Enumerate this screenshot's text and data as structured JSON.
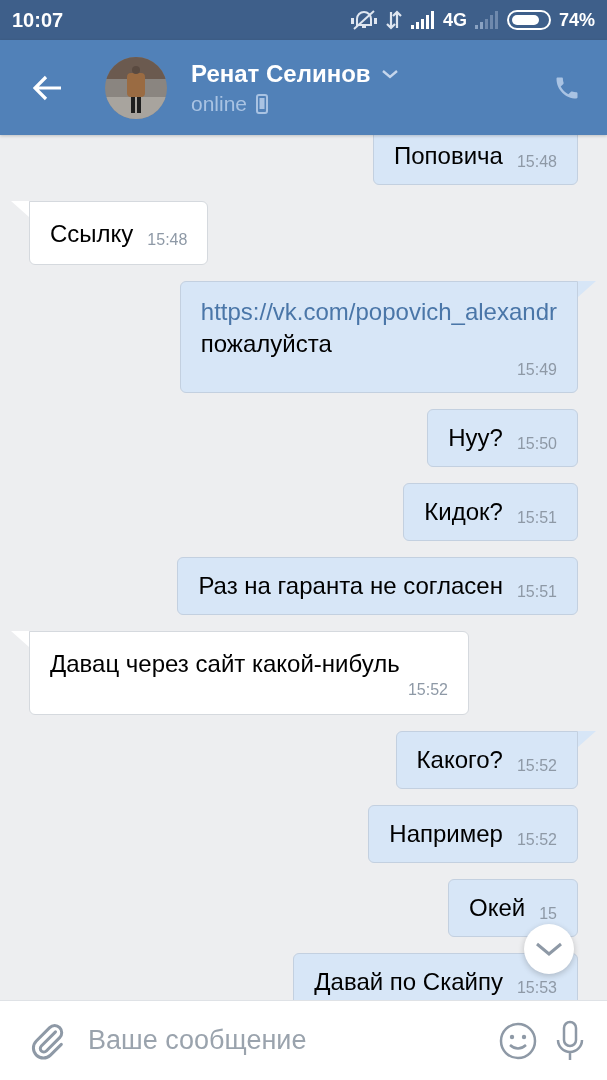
{
  "status_bar": {
    "time": "10:07",
    "network": "4G",
    "battery": "74%"
  },
  "header": {
    "name": "Ренат Селинов",
    "presence": "online"
  },
  "messages": [
    {
      "kind": "outgoing",
      "text": "Поповича",
      "time": "15:48"
    },
    {
      "kind": "incoming",
      "text": "Ссылку",
      "time": "15:48",
      "tail": true
    },
    {
      "kind": "outgoing",
      "link": "https://vk.com/popovich_alexandr",
      "text": "пожалуйста",
      "time": "15:49",
      "tail": true
    },
    {
      "kind": "outgoing",
      "text": "Нуу?",
      "time": "15:50",
      "tail": false
    },
    {
      "kind": "outgoing",
      "text": "Кидок?",
      "time": "15:51",
      "tail": false
    },
    {
      "kind": "outgoing",
      "text": "Раз на гаранта не согласен",
      "time": "15:51",
      "tail": false
    },
    {
      "kind": "incoming",
      "text": "Давац через сайт какой-нибуль",
      "time": "15:52",
      "tail": true
    },
    {
      "kind": "outgoing",
      "text": "Какого?",
      "time": "15:52",
      "tail": true
    },
    {
      "kind": "outgoing",
      "text": "Например",
      "time": "15:52",
      "tail": false
    },
    {
      "kind": "outgoing",
      "text": "Окей",
      "time": "15",
      "tail": false
    },
    {
      "kind": "outgoing",
      "text": "Давай по Скайпу",
      "time": "15:53",
      "tail": false
    }
  ],
  "composer": {
    "placeholder": "Ваше сообщение"
  }
}
